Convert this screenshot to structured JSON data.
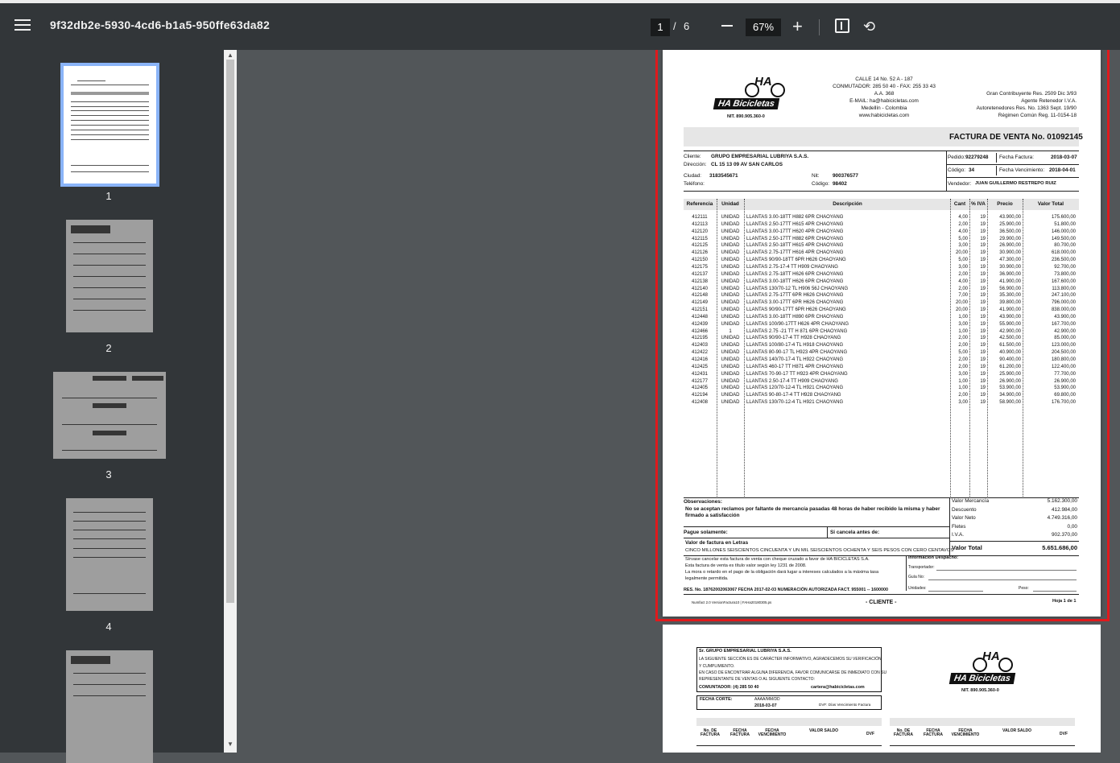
{
  "toolbar": {
    "title": "9f32db2e-5930-4cd6-b1a5-950ffe63da82",
    "current_page": "1",
    "page_separator": "/",
    "total_pages": "6",
    "zoom": "67%"
  },
  "thumbnails": [
    {
      "label": "1",
      "selected": true
    },
    {
      "label": "2",
      "selected": false
    },
    {
      "label": "3",
      "selected": false
    },
    {
      "label": "4",
      "selected": false
    }
  ],
  "invoice": {
    "company": {
      "brand": "HA Bicicletas",
      "nit": "NIT. 890.905.360-0",
      "address_lines": [
        "CALLE 14 No. 52 A - 187",
        "CONMUTADOR: 285 50 40 - FAX: 255 33 43",
        "A.A. 368",
        "E-MAIL: ha@habicicletas.com",
        "Medellín - Colombia",
        "www.habicicletas.com"
      ],
      "tax_lines": [
        "Gran Contribuyente Res. 2509 Dic 3/93",
        "Agente Retenedor I.V.A.",
        "Autoretenedores Res. No. 1363 Sept. 19/90",
        "Régimen Común Reg. 11-0154-18"
      ]
    },
    "title": "FACTURA DE VENTA No. 01092145",
    "client": {
      "cliente_label": "Cliente:",
      "cliente": "GRUPO EMPRESARIAL LUBRIYA S.A.S.",
      "direccion_label": "Dirección:",
      "direccion": "CL 15 13 09 AV SAN CARLOS",
      "ciudad_label": "Ciudad:",
      "ciudad": "3183545671",
      "telefono_label": "Teléfono:",
      "nit_label": "Nit:",
      "nit": "900376577",
      "codigo_label": "Código:",
      "codigo": "98402",
      "pedido_label": "Pedido:",
      "pedido": "92279248",
      "fecha_factura_label": "Fecha Factura:",
      "fecha_factura": "2018-03-07",
      "codigo2_label": "Código:",
      "codigo2": "34",
      "fecha_venc_label": "Fecha Vencimiento:",
      "fecha_venc": "2018-04-01",
      "vendedor_label": "Vendedor:",
      "vendedor": "JUAN GUILLERMO RESTREPO RUIZ"
    },
    "columns": [
      "Referencia",
      "Unidad",
      "Descripción",
      "Cant",
      "% IVA",
      "Precio",
      "Valor Total"
    ],
    "rows": [
      [
        "412111",
        "UNIDAD",
        "LLANTAS 3.00-18TT H882 6PR CHAOYANG",
        "4,00",
        "19",
        "43.900,00",
        "175.600,00"
      ],
      [
        "412113",
        "UNIDAD",
        "LLANTAS 2.50-17TT H615 4PR CHAOYANG",
        "2,00",
        "19",
        "25.900,00",
        "51.800,00"
      ],
      [
        "412120",
        "UNIDAD",
        "LLANTAS 3.00-17TT H620 4PR CHAOYANG",
        "4,00",
        "19",
        "36.500,00",
        "146.000,00"
      ],
      [
        "412115",
        "UNIDAD",
        "LLANTAS 2.50-17TT H882 6PR CHAOYANG",
        "5,00",
        "19",
        "29.900,00",
        "149.500,00"
      ],
      [
        "412125",
        "UNIDAD",
        "LLANTAS 2.50-18TT H615 4PR CHAOYANG",
        "3,00",
        "19",
        "26.900,00",
        "80.700,00"
      ],
      [
        "412126",
        "UNIDAD",
        "LLANTAS 2.75-17TT H616 4PR CHAOYANG",
        "20,00",
        "19",
        "30.900,00",
        "618.000,00"
      ],
      [
        "412150",
        "UNIDAD",
        "LLANTAS 90/90-18TT 6PR H626 CHAOYANG",
        "5,00",
        "19",
        "47.300,00",
        "236.500,00"
      ],
      [
        "412175",
        "UNIDAD",
        "LLANTAS 2.75-17-4 TT H909 CHAOYANG",
        "3,00",
        "19",
        "30.900,00",
        "92.700,00"
      ],
      [
        "412137",
        "UNIDAD",
        "LLANTAS 2.75-18TT H626 6PR CHAOYANG",
        "2,00",
        "19",
        "36.900,00",
        "73.800,00"
      ],
      [
        "412138",
        "UNIDAD",
        "LLANTAS 3.00-18TT H626 6PR CHAOYANG",
        "4,00",
        "19",
        "41.900,00",
        "167.600,00"
      ],
      [
        "412140",
        "UNIDAD",
        "LLANTAS 130/70-12 TL H906 56J CHAOYANG",
        "2,00",
        "19",
        "56.900,00",
        "113.800,00"
      ],
      [
        "412148",
        "UNIDAD",
        "LLANTAS 2.75-17TT 6PR H626 CHAOYANG",
        "7,00",
        "19",
        "35.300,00",
        "247.100,00"
      ],
      [
        "412149",
        "UNIDAD",
        "LLANTAS 3.00-17TT 6PR H626 CHAOYANG",
        "20,00",
        "19",
        "39.800,00",
        "796.000,00"
      ],
      [
        "412151",
        "UNIDAD",
        "LLANTAS 90/90-17TT 6PR H626 CHAOYANG",
        "20,00",
        "19",
        "41.900,00",
        "838.000,00"
      ],
      [
        "412448",
        "UNIDAD",
        "LLANTAS 3.00-18TT H890 6PR CHAOYANG",
        "1,00",
        "19",
        "43.900,00",
        "43.900,00"
      ],
      [
        "412439",
        "UNIDAD",
        "LLANTAS 100/90-17TT H626 4PR CHAOYANG",
        "3,00",
        "19",
        "55.900,00",
        "167.700,00"
      ],
      [
        "412466",
        "1",
        "LLANTAS 2.75 -21 TT H 871 6PR  CHAOYANG",
        "1,00",
        "19",
        "42.900,00",
        "42.900,00"
      ],
      [
        "412195",
        "UNIDAD",
        "LLANTAS 90/90-17-4 TT H928 CHAOYANG",
        "2,00",
        "19",
        "42.500,00",
        "85.000,00"
      ],
      [
        "412403",
        "UNIDAD",
        "LLANTAS 100/80-17-4 TL H918 CHAOYANG",
        "2,00",
        "19",
        "61.500,00",
        "123.000,00"
      ],
      [
        "412422",
        "UNIDAD",
        "LLANTAS 80-90-17 TL H923 4PR CHAOYANG",
        "5,00",
        "19",
        "40.900,00",
        "204.500,00"
      ],
      [
        "412416",
        "UNIDAD",
        "LLANTAS 140/70-17-4 TL H922 CHAOYANG",
        "2,00",
        "19",
        "90.400,00",
        "180.800,00"
      ],
      [
        "412425",
        "UNIDAD",
        "LLANTAS 460-17 TT H871 4PR CHAOYANG",
        "2,00",
        "19",
        "61.200,00",
        "122.400,00"
      ],
      [
        "412431",
        "UNIDAD",
        "LLANTAS  70-90-17 TT H923 4PR CHAOYANG",
        "3,00",
        "19",
        "25.900,00",
        "77.700,00"
      ],
      [
        "412177",
        "UNIDAD",
        "LLANTAS 2.50-17-4 TT H909 CHAOYANG",
        "1,00",
        "19",
        "26.900,00",
        "26.900,00"
      ],
      [
        "412405",
        "UNIDAD",
        "LLANTAS 120/70-12-4 TL H921 CHAOYANG",
        "1,00",
        "19",
        "53.900,00",
        "53.900,00"
      ],
      [
        "412194",
        "UNIDAD",
        "LLANTAS 90-80-17-4 TT H928 CHAOYANG",
        "2,00",
        "19",
        "34.900,00",
        "69.800,00"
      ],
      [
        "412408",
        "UNIDAD",
        "LLANTAS 130/70-12-4 TL H921 CHAOYANG",
        "3,00",
        "19",
        "58.900,00",
        "176.700,00"
      ]
    ],
    "observaciones_label": "Observaciones:",
    "observaciones": "No se aceptan reclamos por faltante de mercancía pasadas 48 horas de haber recibido la misma y haber firmado a satisfacción",
    "pague_label": "Pague solamente:",
    "si_cancela_label": "Si cancela antes de:",
    "letras_label": "Valor de factura en Letras",
    "letras": "CINCO MILLONES SEISCIENTOS CINCUENTA Y UN MIL SEISCIENTOS OCHENTA Y SEIS PESOS CON CERO CENTAVOS",
    "terms": [
      "Sírvase cancelar esta factura de venta con cheque cruzado a favor de HA BICICLETAS S.A.",
      "Esta factura de venta es título valor según ley 1231 de 2008.",
      "La mora o retardo en el pago de la obligación dará lugar a intereses calculados a la máxima tasa",
      "legalmente permitida."
    ],
    "despacho_label": "Información Despacho:",
    "transportador_label": "Transportador:",
    "guia_label": "Guía No:",
    "unidades_label": "Unidades:",
    "peso_label": "Peso:",
    "resolution": "RES. No. 18762002063067 FECHA  2017-02-03   NUMERACIÓN AUTORIZADA FACT. 955001 -- 1600000",
    "footer_small": "Numfact 2.0 VersionFactura10 | FAHa20180305.ps",
    "copy_label": "- CLIENTE -",
    "sheet": "Hoja 1 de 1",
    "totals": [
      {
        "label": "Valor Mercancía",
        "value": "5.162.300,00"
      },
      {
        "label": "Descuento",
        "value": "412.984,00"
      },
      {
        "label": "Valor Neto",
        "value": "4.749.316,00"
      },
      {
        "label": "Fletes",
        "value": "0,00"
      },
      {
        "label": "I.V.A.",
        "value": "902.370,00"
      }
    ],
    "total_label": "Valor Total",
    "total_value": "5.651.686,00"
  },
  "page2": {
    "lines": [
      "Sr. GRUPO EMPRESARIAL LUBRIYA S.A.S.",
      "LA SIGUIENTE SECCIÓN ES DE CARÁCTER INFORMATIVO, AGRADECEMOS SU VERIFICACIÓN",
      "Y CUMPLIMIENTO.",
      "EN CASO DE ENCONTRAR ALGUNA DIFERENCIA, FAVOR COMUNICARSE DE INMEDIATO CON SU",
      "REPRESENTANTE DE VENTAS O AL SIGUIENTE CONTACTO:"
    ],
    "conmutador": "COMUNTADOR: (4) 285 50 40",
    "email": "cartera@habicicletas.com",
    "fecha_corte_label": "FECHA CORTE:",
    "fecha_format": "AAAA/MM/DD",
    "fecha_corte": "2018-03-07",
    "dvf_note": "DVF: Días Vencimiento Factura",
    "brand": "HA Bicicletas",
    "nit": "NIT. 890.905.360-0",
    "cols": [
      "No. DE FACTURA",
      "FECHA FACTURA",
      "FECHA VENCIMIENTO",
      "VALOR SALDO",
      "DVF"
    ]
  },
  "colors": {
    "toolbar": "#323639",
    "viewer_bg": "#525659",
    "highlight": "#e0191c",
    "thumb_selected": "#8ab4f8"
  }
}
